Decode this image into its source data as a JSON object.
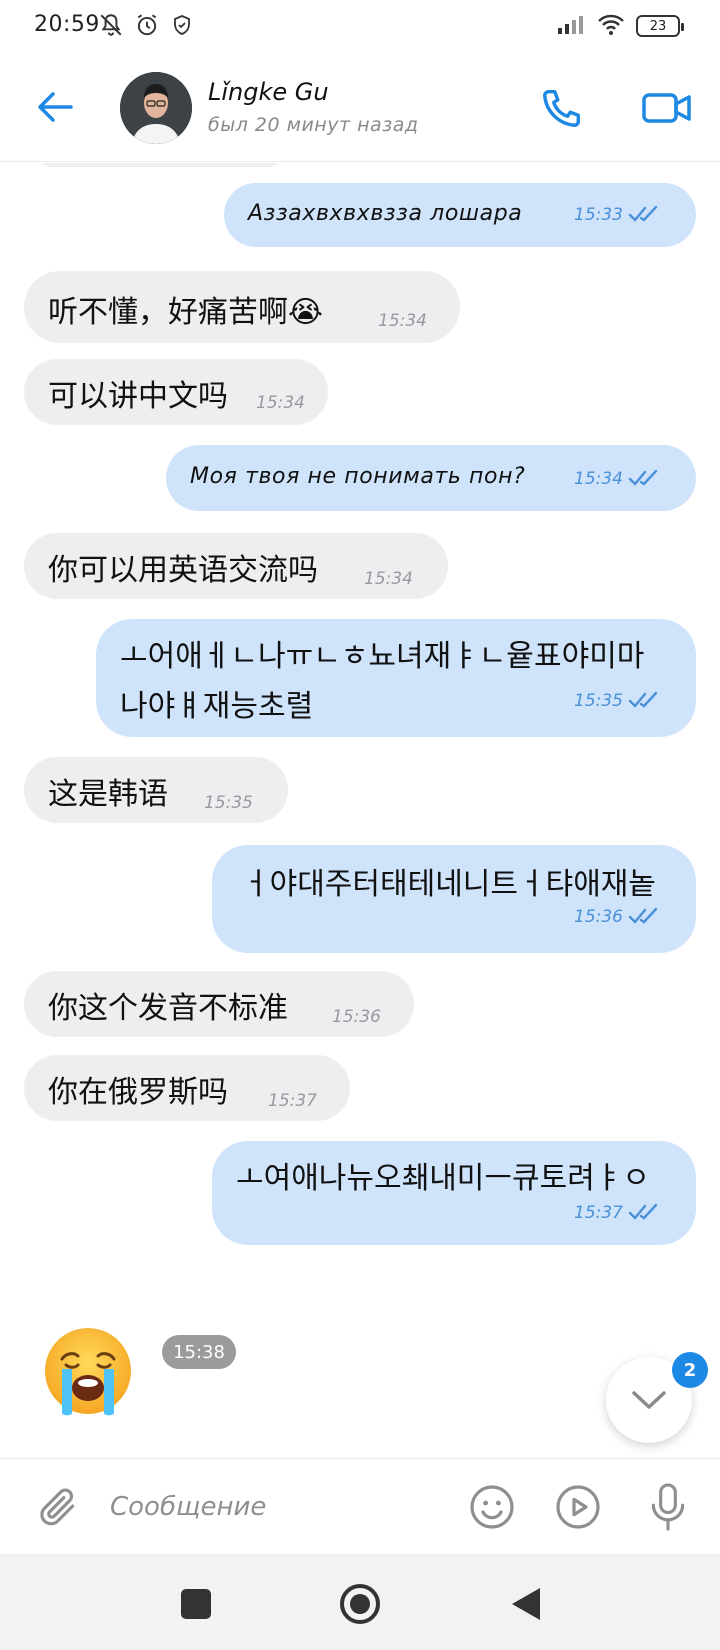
{
  "status_bar": {
    "time": "20:59",
    "battery": "23"
  },
  "header": {
    "contact_name": "Lǐngke Gu",
    "contact_status": "был 20 минут назад"
  },
  "messages": [
    {
      "direction": "out",
      "text": "Аззахвхвхвзза лошара",
      "time": "15:33",
      "read": true
    },
    {
      "direction": "in",
      "text": "听不懂，好痛苦啊😭",
      "time": "15:34"
    },
    {
      "direction": "in",
      "text": "可以讲中文吗",
      "time": "15:34"
    },
    {
      "direction": "out",
      "text": "Моя твоя не понимать пон?",
      "time": "15:34",
      "read": true
    },
    {
      "direction": "in",
      "text": "你可以用英语交流吗",
      "time": "15:34"
    },
    {
      "direction": "out",
      "text_lines": [
        "ㅗ어애ㅔㄴ나ㅠㄴㅎ뇨녀재ㅑㄴ윹표야미마",
        "나야ㅒ재능초렬"
      ],
      "time": "15:35",
      "read": true
    },
    {
      "direction": "in",
      "text": "这是韩语",
      "time": "15:35"
    },
    {
      "direction": "out",
      "text": "ㅓ야대주터태테네니트ㅓ탸애재놑",
      "time": "15:36",
      "read": true
    },
    {
      "direction": "in",
      "text": "你这个发音不标准",
      "time": "15:36"
    },
    {
      "direction": "in",
      "text": "你在俄罗斯吗",
      "time": "15:37"
    },
    {
      "direction": "out",
      "text": "ㅗ여애나뉴오쵀내미ㅡ큐토려ㅑㅇ",
      "time": "15:37",
      "read": true
    },
    {
      "direction": "in",
      "emoji": "loudly-crying-face",
      "time": "15:38"
    }
  ],
  "scroll_down": {
    "unread_count": "2"
  },
  "composer": {
    "placeholder": "Сообщение"
  },
  "colors": {
    "accent": "#1e88e5",
    "incoming_bubble": "#eeeef1",
    "outgoing_bubble": "#cfe4fb",
    "outgoing_time": "#4a90d9"
  }
}
